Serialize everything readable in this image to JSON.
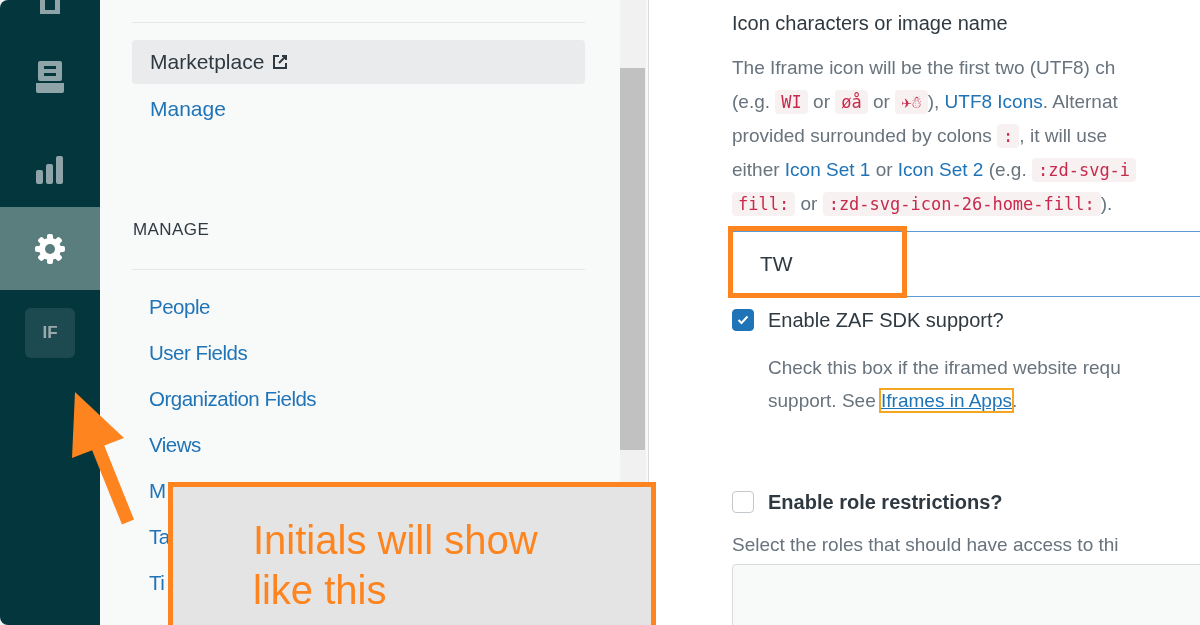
{
  "nav": {
    "items": [
      {
        "kind": "home",
        "selected": false
      },
      {
        "kind": "inbox",
        "selected": false
      },
      {
        "kind": "chart",
        "selected": false
      },
      {
        "kind": "gear",
        "selected": true
      },
      {
        "kind": "badge",
        "text": "IF",
        "selected": false
      }
    ]
  },
  "sidebar": {
    "items": [
      {
        "label": "Marketplace",
        "selected": true,
        "external": true
      },
      {
        "label": "Manage",
        "selected": false,
        "external": false
      }
    ],
    "sections": [
      {
        "heading": "MANAGE",
        "items": [
          {
            "label": "People"
          },
          {
            "label": "User Fields"
          },
          {
            "label": "Organization Fields"
          },
          {
            "label": "Views"
          },
          {
            "label": "M"
          },
          {
            "label": "Ta"
          },
          {
            "label": "Ti"
          }
        ]
      }
    ]
  },
  "form": {
    "icon_field": {
      "label": "Icon characters or image name",
      "help_lines": [
        [
          {
            "kind": "text",
            "text": "The Iframe icon will be the first two (UTF8) ch"
          }
        ],
        [
          {
            "kind": "text",
            "text": "(e.g. "
          },
          {
            "kind": "code",
            "text": "WI"
          },
          {
            "kind": "text",
            "text": " or "
          },
          {
            "kind": "code",
            "text": "øå"
          },
          {
            "kind": "text",
            "text": " or "
          },
          {
            "kind": "code",
            "text": "✈☃"
          },
          {
            "kind": "text",
            "text": "), "
          },
          {
            "kind": "link",
            "text": "UTF8 Icons"
          },
          {
            "kind": "text",
            "text": ". Alternat"
          }
        ],
        [
          {
            "kind": "text",
            "text": "provided surrounded by colons "
          },
          {
            "kind": "code",
            "text": ":"
          },
          {
            "kind": "text",
            "text": ", it will use"
          }
        ],
        [
          {
            "kind": "text",
            "text": "either "
          },
          {
            "kind": "link",
            "text": "Icon Set 1"
          },
          {
            "kind": "text",
            "text": " or "
          },
          {
            "kind": "link",
            "text": "Icon Set 2"
          },
          {
            "kind": "text",
            "text": " (e.g. "
          },
          {
            "kind": "code",
            "text": ":zd-svg-i"
          }
        ],
        [
          {
            "kind": "code",
            "text": "fill:"
          },
          {
            "kind": "text",
            "text": " or "
          },
          {
            "kind": "code",
            "text": ":zd-svg-icon-26-home-fill:"
          },
          {
            "kind": "text",
            "text": ")."
          }
        ]
      ],
      "value": "TW"
    },
    "zaf": {
      "label": "Enable ZAF SDK support?",
      "checked": true,
      "help": "Check this box if the iframed website requ",
      "help2": "support. See ",
      "link": "Iframes in Apps",
      "after": "."
    },
    "roles": {
      "label": "Enable role restrictions?",
      "checked": false,
      "help": "Select the roles that should have access to thi"
    }
  },
  "annotation": {
    "callout": "Initials will show like this"
  }
}
